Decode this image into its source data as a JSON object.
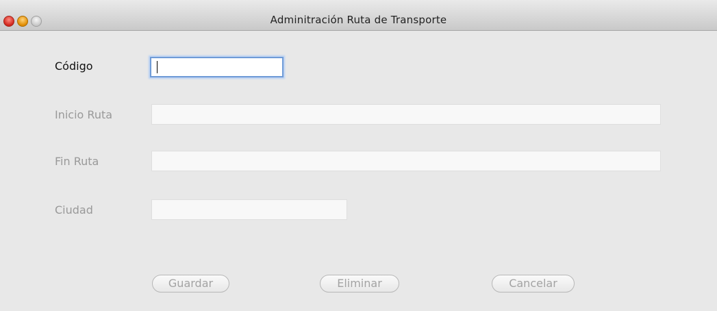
{
  "window": {
    "title": "Adminitración Ruta de Transporte"
  },
  "form": {
    "fields": [
      {
        "name": "codigo",
        "label": "Código",
        "value": ""
      },
      {
        "name": "inicio_ruta",
        "label": "Inicio Ruta",
        "value": ""
      },
      {
        "name": "fin_ruta",
        "label": "Fin Ruta",
        "value": ""
      },
      {
        "name": "ciudad",
        "label": "Ciudad",
        "value": ""
      }
    ],
    "buttons": {
      "guardar": "Guardar",
      "eliminar": "Eliminar",
      "cancelar": "Cancelar"
    }
  }
}
